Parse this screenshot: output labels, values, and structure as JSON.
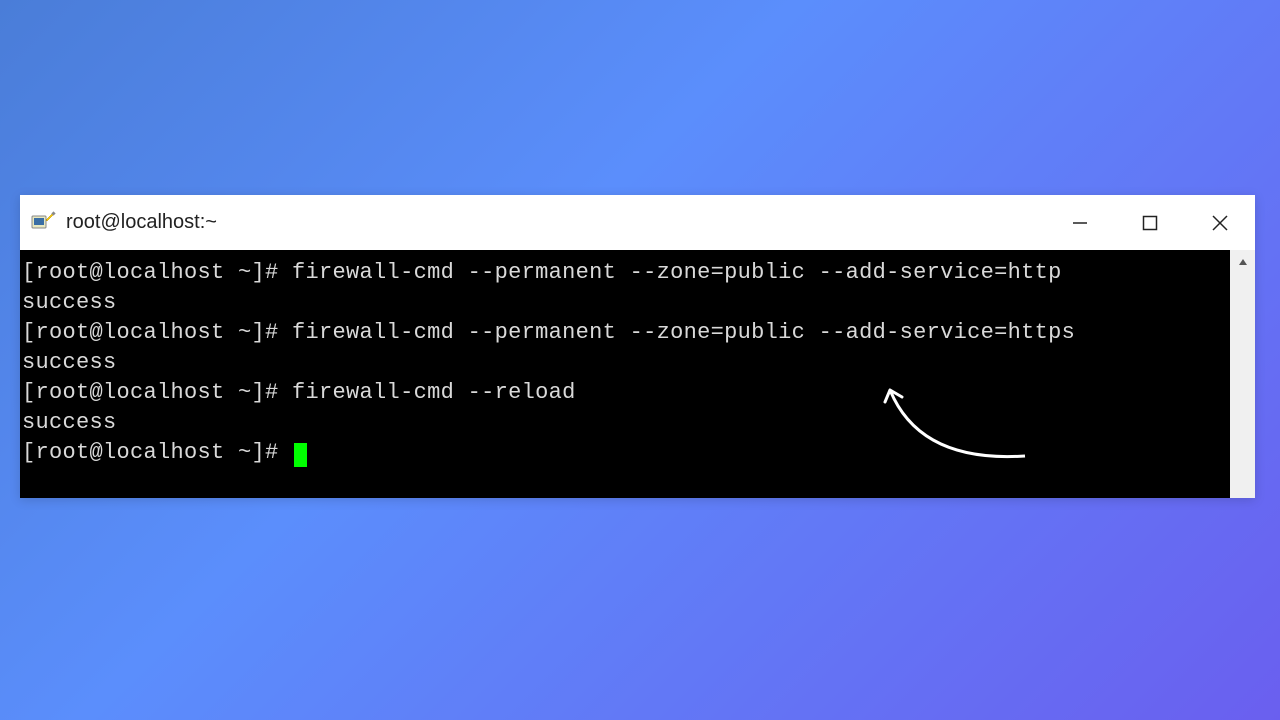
{
  "window": {
    "title": "root@localhost:~"
  },
  "terminal": {
    "prompt": "[root@localhost ~]# ",
    "lines": [
      {
        "cmd": "firewall-cmd --permanent --zone=public --add-service=http",
        "out": "success"
      },
      {
        "cmd": "firewall-cmd --permanent --zone=public --add-service=https",
        "out": "success"
      },
      {
        "cmd": "firewall-cmd --reload",
        "out": "success"
      }
    ]
  }
}
